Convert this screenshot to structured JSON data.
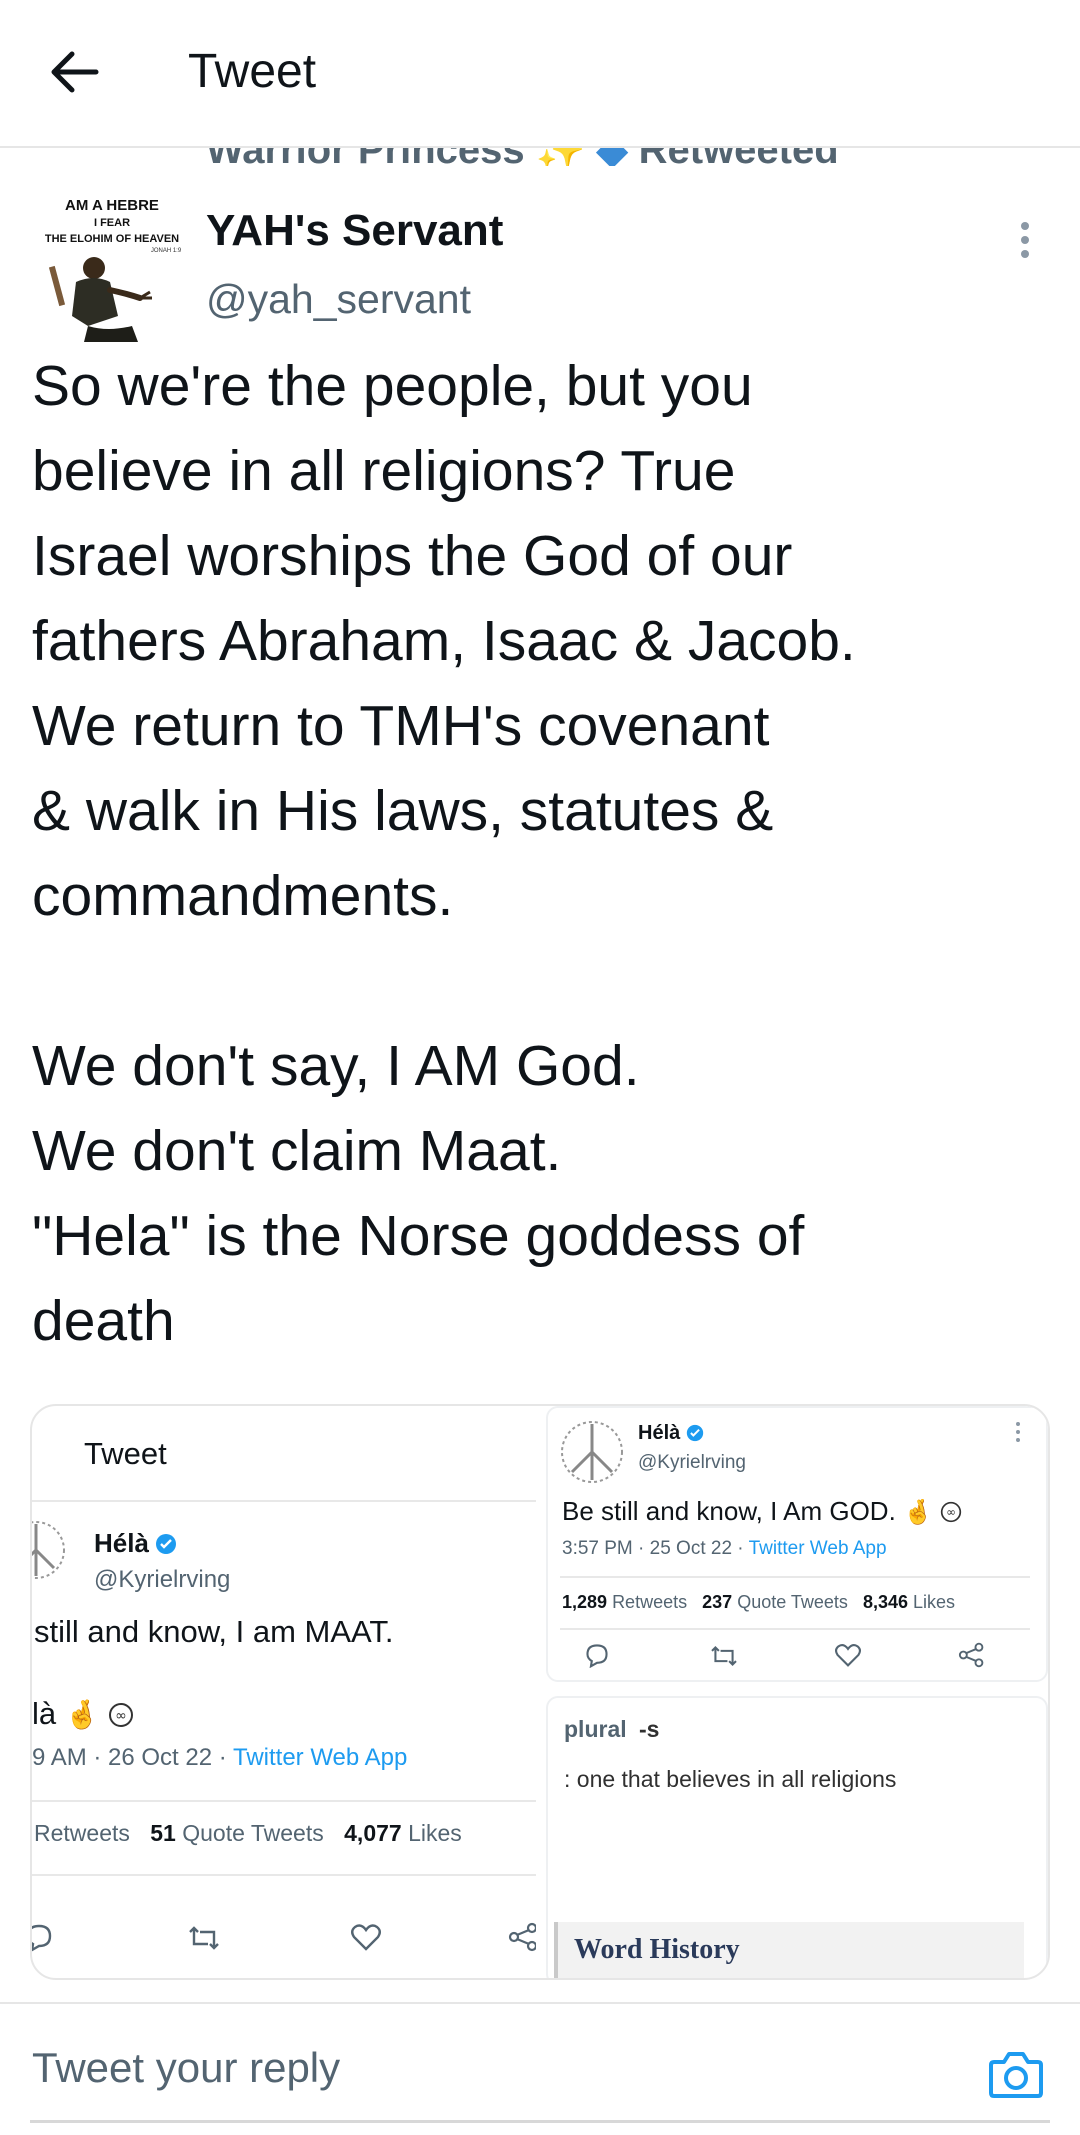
{
  "header": {
    "title": "Tweet"
  },
  "retweet_banner": {
    "name": "Warrior Princess",
    "text": "Retweeted",
    "sparkle_icon": "sparkles-icon",
    "diamond_icon": "blue-diamond-icon"
  },
  "avatar_text": {
    "line1": "AM A HEBRE",
    "line2": "I FEAR",
    "line3": "THE ELOHIM OF HEAVEN",
    "line4": "JONAH 1:9"
  },
  "author": {
    "name": "YAH's Servant",
    "handle": "@yah_servant"
  },
  "tweet": {
    "text": "So we're the people, but you\nbelieve in all religions? True\nIsrael worships the God of our\nfathers Abraham, Isaac & Jacob.\nWe return to TMH's covenant\n& walk in His laws, statutes &\ncommandments.\n\nWe don't say, I AM God.\nWe don't claim Maat.\n\"Hela\" is the Norse goddess of\ndeath"
  },
  "left_image": {
    "header_title": "Tweet",
    "name": "Hélà",
    "handle": "@Kyrielrving",
    "text": "still and know, I am MAAT.",
    "sign": "là",
    "time": "9 AM · 26 Oct 22 · ",
    "source": "Twitter Web App",
    "retweets_label": "Retweets",
    "quote_count": "51",
    "quote_label": "Quote Tweets",
    "likes_count": "4,077",
    "likes_label": "Likes"
  },
  "right_image": {
    "name": "Hélà",
    "handle": "@Kyrielrving",
    "text": "Be still and know, I Am GOD.",
    "time": "3:57 PM · 25 Oct 22 · ",
    "source": "Twitter Web App",
    "retweets_count": "1,289",
    "retweets_label": "Retweets",
    "quote_count": "237",
    "quote_label": "Quote Tweets",
    "likes_count": "8,346",
    "likes_label": "Likes",
    "dict_pos": "plural",
    "dict_suffix": "-s",
    "dict_def": ": one that believes in all religions",
    "word_history": "Word History"
  },
  "reply": {
    "placeholder": "Tweet your reply"
  },
  "colors": {
    "accent": "#1d9bf0",
    "muted": "#536471",
    "text": "#0f1419"
  }
}
